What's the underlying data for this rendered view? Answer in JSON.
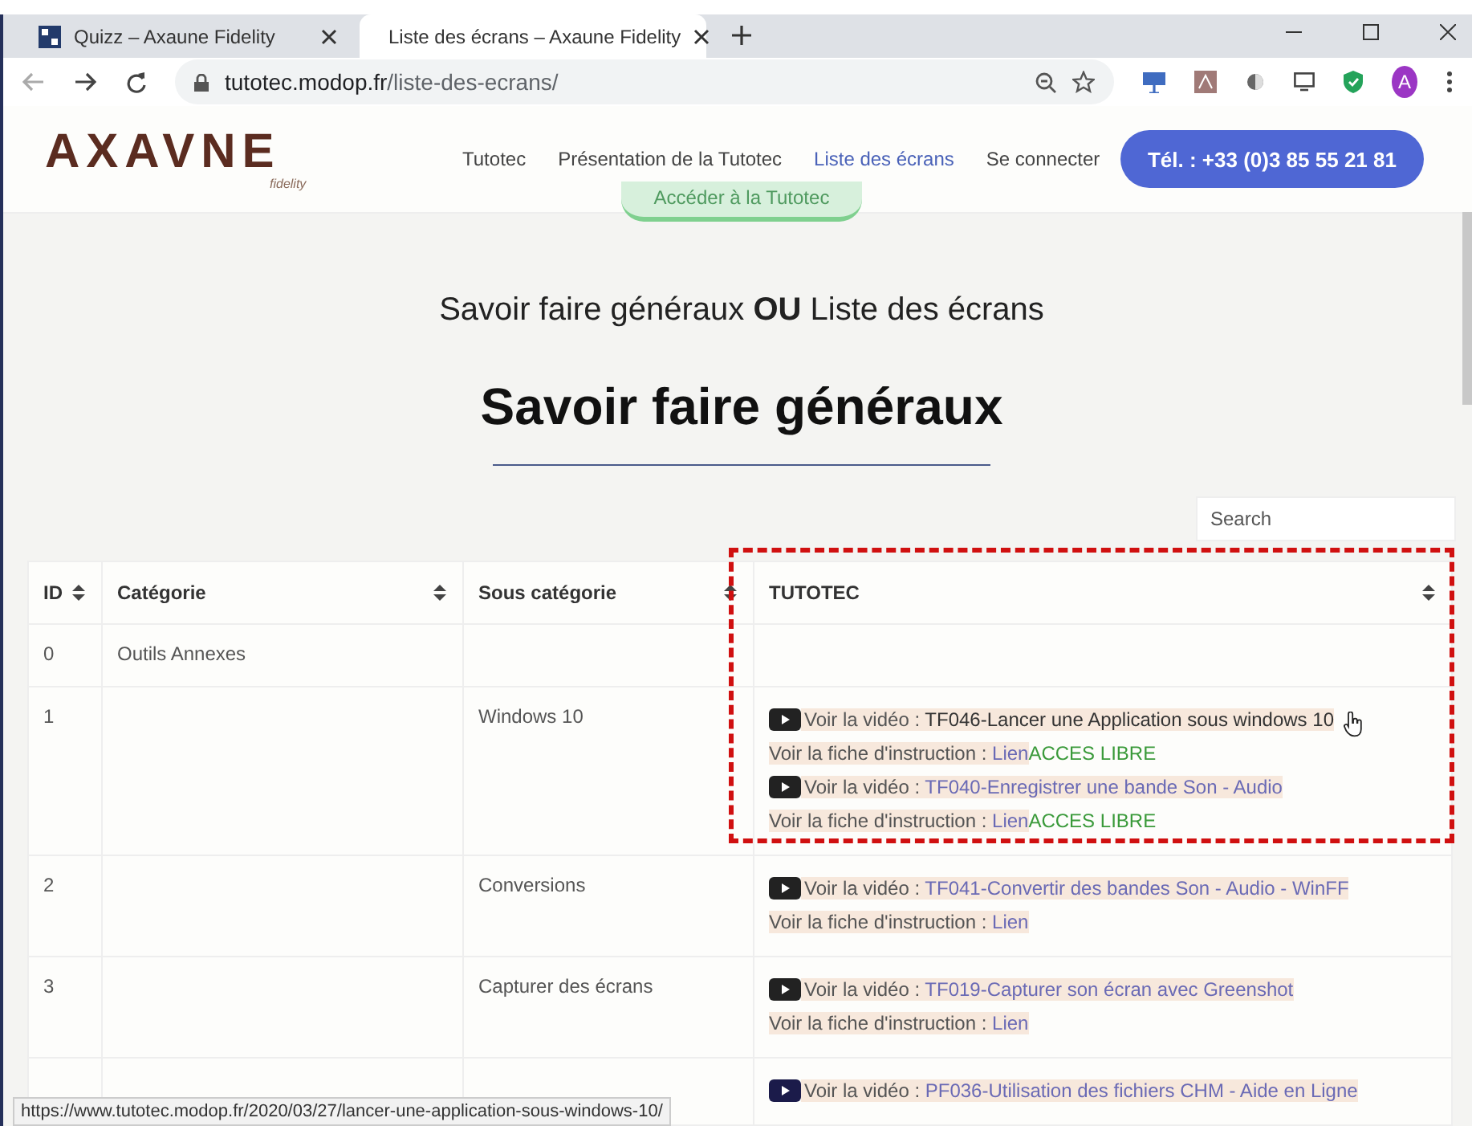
{
  "browser": {
    "tabs": [
      {
        "title": "Quizz – Axaune Fidelity",
        "selected": false
      },
      {
        "title": "Liste des écrans – Axaune Fidelity",
        "selected": true
      }
    ],
    "url_host": "tutotec.modop.fr",
    "url_path": "/liste-des-ecrans/",
    "profile_initial": "A"
  },
  "site": {
    "logo": "AXAVNE",
    "logo_sub": "fidelity",
    "nav": [
      {
        "label": "Tutotec",
        "selected": false
      },
      {
        "label": "Présentation de la Tutotec",
        "selected": false
      },
      {
        "label": "Liste des écrans",
        "selected": true
      },
      {
        "label": "Se connecter",
        "selected": false
      }
    ],
    "phone_button": "Tél. : +33 (0)3 85 55 21 81",
    "faded_button": "Accéder à la Tutotec"
  },
  "intro": "Savoir faire généraux **OU** Liste des écrans",
  "heading": "Savoir faire généraux",
  "search": {
    "placeholder": "Search"
  },
  "table": {
    "columns": [
      "ID",
      "Catégorie",
      "Sous catégorie",
      "TUTOTEC"
    ],
    "rows": [
      {
        "id": "0",
        "category": "Outils Annexes",
        "sub_category": "",
        "tutotec": []
      },
      {
        "id": "1",
        "category": "",
        "sub_category": "Windows 10",
        "highlighted": true,
        "tutotec": [
          {
            "kind": "video",
            "prefix": "Voir la vidéo : ",
            "title": "TF046-Lancer une Application sous windows 10",
            "hovered": true
          },
          {
            "kind": "sheet",
            "prefix": "Voir la fiche d'instruction : ",
            "link": "Lien",
            "badge": "ACCES LIBRE"
          },
          {
            "kind": "video",
            "prefix": "Voir la vidéo : ",
            "title": "TF040-Enregistrer une bande Son - Audio",
            "hovered": false
          },
          {
            "kind": "sheet",
            "prefix": "Voir la fiche d'instruction : ",
            "link": "Lien",
            "badge": "ACCES LIBRE"
          }
        ]
      },
      {
        "id": "2",
        "category": "",
        "sub_category": "Conversions",
        "tutotec": [
          {
            "kind": "video",
            "prefix": "Voir la vidéo : ",
            "title": "TF041-Convertir des bandes Son - Audio - WinFF",
            "hovered": false
          },
          {
            "kind": "sheet",
            "prefix": "Voir la fiche d'instruction : ",
            "link": "Lien"
          }
        ]
      },
      {
        "id": "3",
        "category": "",
        "sub_category": "Capturer des écrans",
        "tutotec": [
          {
            "kind": "video",
            "prefix": "Voir la vidéo : ",
            "title": "TF019-Capturer son écran avec Greenshot",
            "hovered": false
          },
          {
            "kind": "sheet",
            "prefix": "Voir la fiche d'instruction : ",
            "link": "Lien"
          }
        ]
      },
      {
        "id": "",
        "category": "",
        "sub_category": "",
        "tutotec": [
          {
            "kind": "video",
            "prefix": "Voir la vidéo : ",
            "title": "PF036-Utilisation des fichiers CHM - Aide en Ligne",
            "hovered": false
          }
        ]
      }
    ]
  },
  "status_bar": "https://www.tutotec.modop.fr/2020/03/27/lancer-une-application-sous-windows-10/"
}
